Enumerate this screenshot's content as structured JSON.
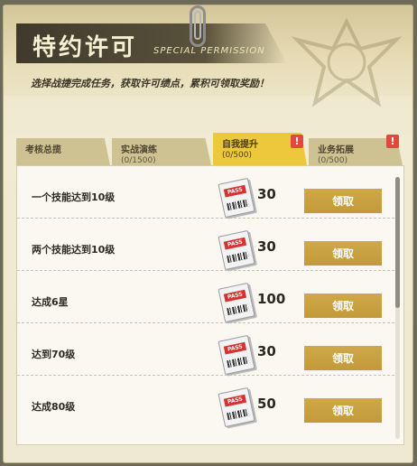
{
  "header": {
    "title": "特约许可",
    "subtitle": "SPECIAL PERMISSION",
    "description": "选择战捷完成任务，获取许可绩点，累积可领取奖励！"
  },
  "tabs": [
    {
      "name": "考核总揽",
      "count": "",
      "active": false,
      "alert": false
    },
    {
      "name": "实战演练",
      "count": "(0/1500)",
      "active": false,
      "alert": false
    },
    {
      "name": "自我提升",
      "count": "(0/500)",
      "active": true,
      "alert": true
    },
    {
      "name": "业务拓展",
      "count": "(0/500)",
      "active": false,
      "alert": true
    }
  ],
  "alert_symbol": "!",
  "tasks": [
    {
      "label": "一个技能达到10级",
      "ticket_text": "PASS",
      "reward": "30",
      "button": "领取"
    },
    {
      "label": "两个技能达到10级",
      "ticket_text": "PASS",
      "reward": "30",
      "button": "领取"
    },
    {
      "label": "达成6星",
      "ticket_text": "PASS",
      "reward": "100",
      "button": "领取"
    },
    {
      "label": "达到70级",
      "ticket_text": "PASS",
      "reward": "30",
      "button": "领取"
    },
    {
      "label": "达成80级",
      "ticket_text": "PASS",
      "reward": "50",
      "button": "领取"
    }
  ],
  "colors": {
    "active_tab": "#eec83b",
    "claim_button": "#c7a13f",
    "alert": "#e04a3c"
  }
}
